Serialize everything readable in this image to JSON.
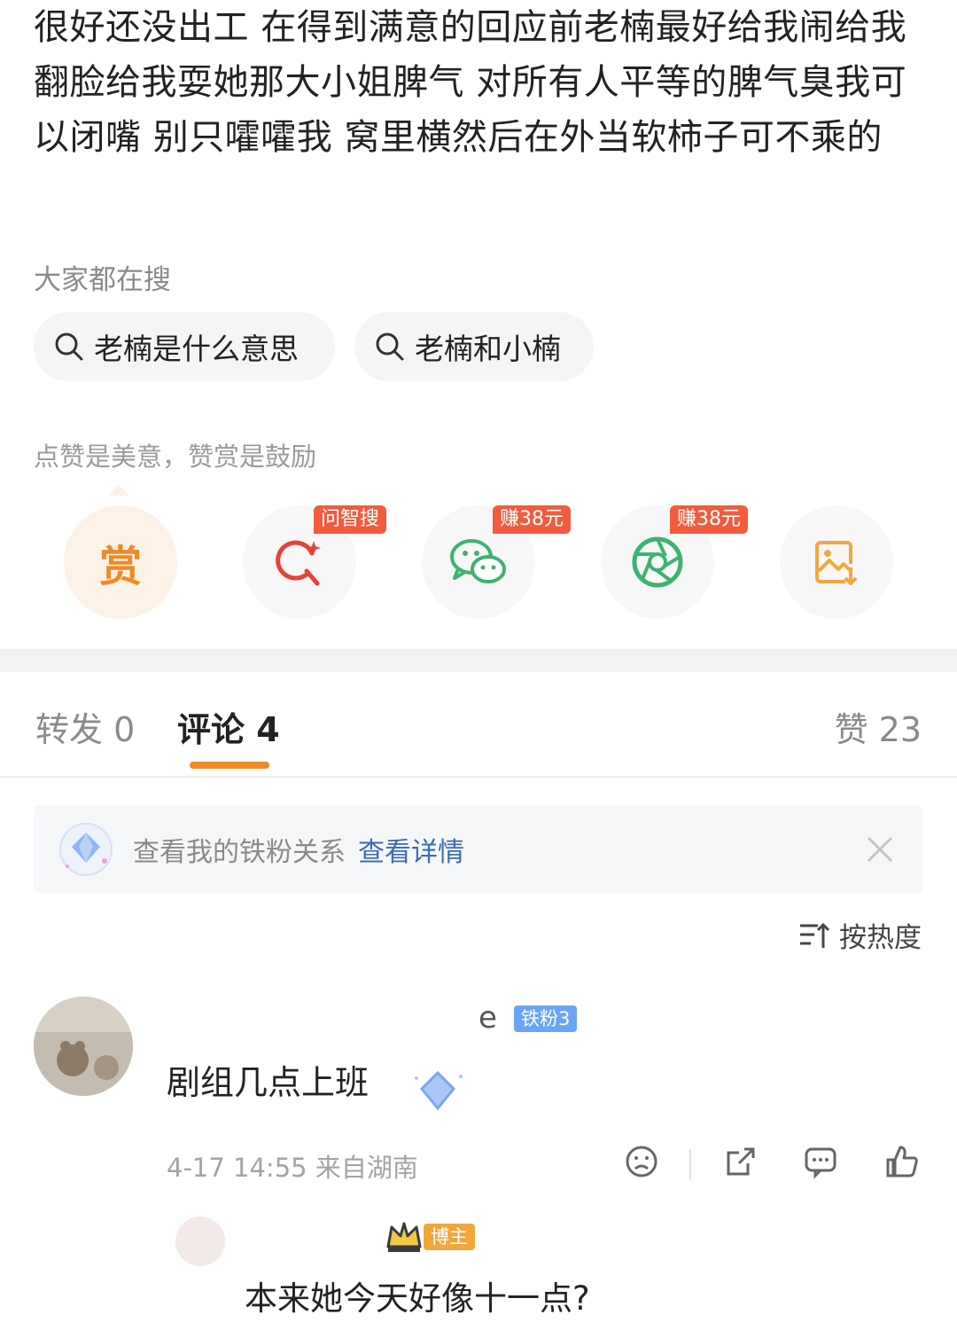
{
  "post": {
    "text": "很好还没出工 在得到满意的回应前老楠最好给我闹给我翻脸给我耍她那大小姐脾气 对所有人平等的脾气臭我可以闭嘴 别只嚯嚯我 窝里横然后在外当软柿子可不乘的"
  },
  "search_section": {
    "label": "大家都在搜",
    "items": [
      "老楠是什么意思",
      "老楠和小楠"
    ]
  },
  "reward_section": {
    "tip": "点赞是美意，赞赏是鼓励",
    "reward_label": "赏",
    "badges": {
      "ask": "问智搜",
      "wechat": "赚38元",
      "moments": "赚38元"
    },
    "icons": [
      "reward-icon",
      "ai-search-icon",
      "wechat-icon",
      "moments-icon",
      "save-image-icon"
    ]
  },
  "tabs": {
    "repost": "转发 0",
    "comments": "评论 4",
    "likes": "赞 23"
  },
  "fan_banner": {
    "text": "查看我的铁粉关系",
    "link": "查看详情"
  },
  "sort": {
    "label": "按热度"
  },
  "comments": [
    {
      "username_visible": "e",
      "badge": "铁粉3",
      "text": "剧组几点上班",
      "meta": "4-17 14:55  来自湖南"
    }
  ],
  "reply": {
    "badge": "博主",
    "text": "本来她今天好像十一点?"
  },
  "colors": {
    "accent_orange": "#f08a24",
    "badge_red": "#f25b3e",
    "link_blue": "#3b6bb5",
    "wechat_green": "#3cb371"
  }
}
